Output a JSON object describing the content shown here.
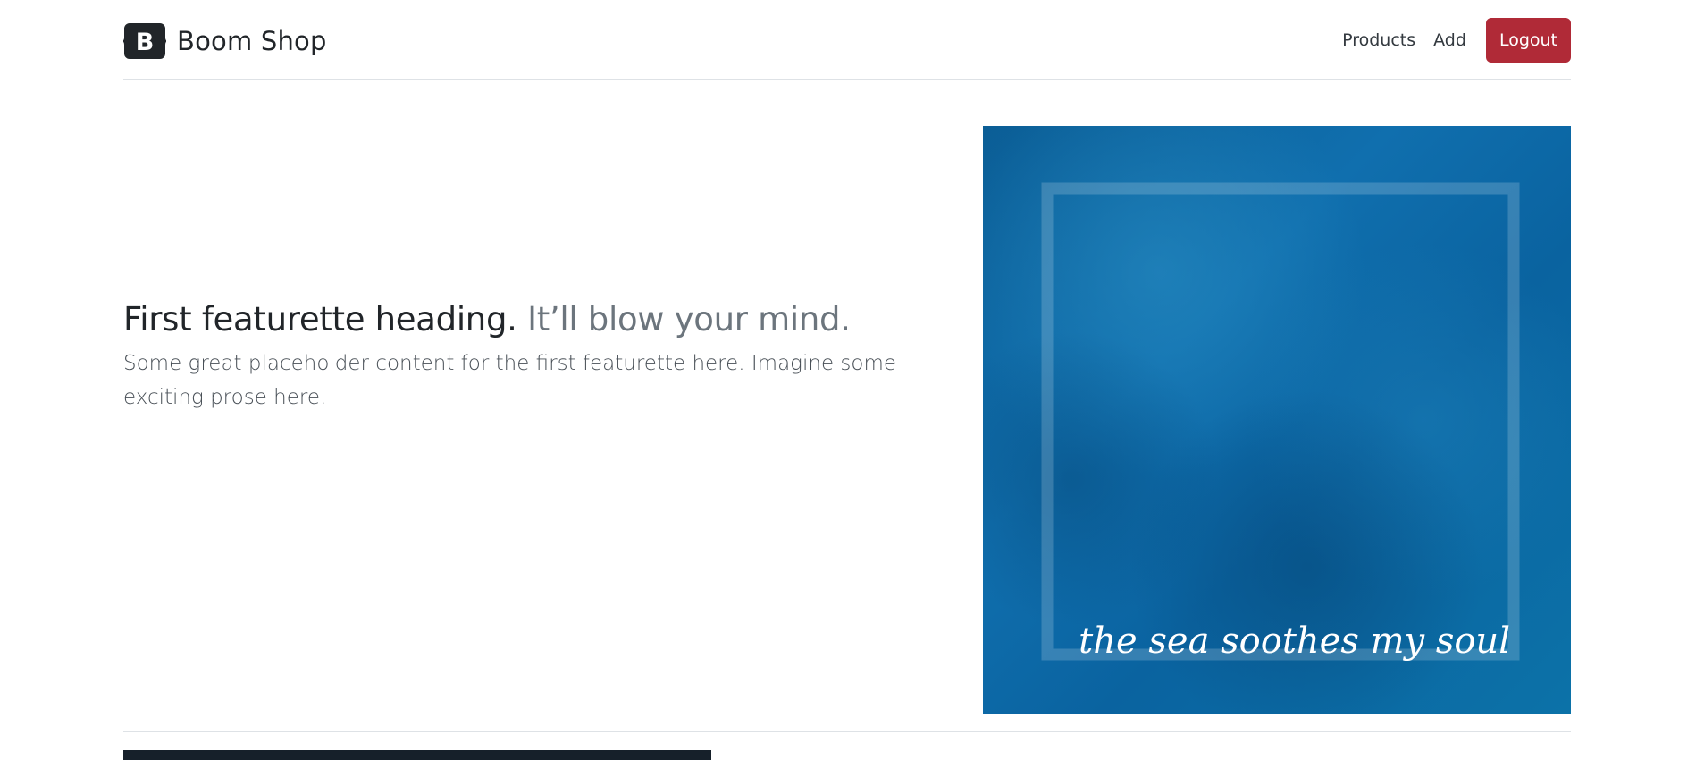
{
  "brand": {
    "logo_letter": "B",
    "name": "Boom Shop"
  },
  "nav": {
    "products_label": "Products",
    "add_label": "Add",
    "logout_label": "Logout"
  },
  "featurette": {
    "heading": "First featurette heading.",
    "heading_muted": "It’ll blow your mind.",
    "lead": "Some great placeholder content for the first featurette here. Imagine some exciting prose here.",
    "image_caption": "the sea soothes my soul"
  },
  "colors": {
    "logout_button": "#b02a37",
    "text_dark": "#212529",
    "text_muted": "#6c757d",
    "sea_blue": "#0d6aa3"
  }
}
